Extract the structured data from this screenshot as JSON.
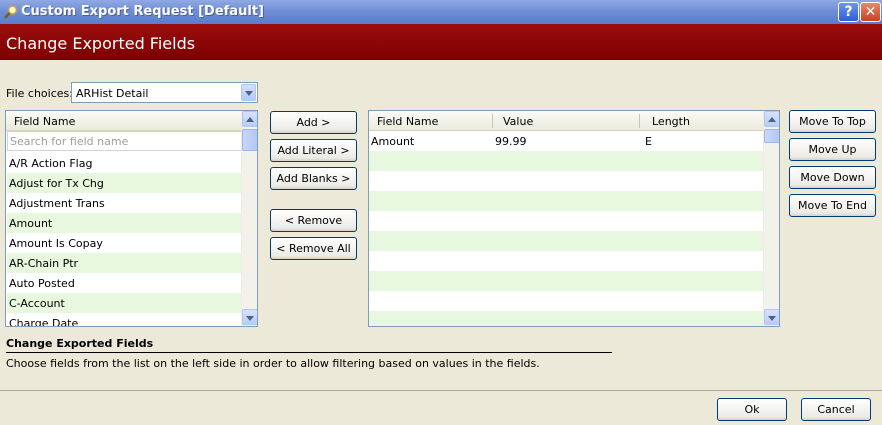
{
  "window": {
    "title": "Custom Export Request [Default]",
    "help_label": "?",
    "close_label": "✕"
  },
  "banner": {
    "title": "Change Exported Fields"
  },
  "file_choices": {
    "label": "File choices:",
    "selected": "ARHist Detail"
  },
  "left_list": {
    "header": "Field Name",
    "search_placeholder": "Search for field name",
    "items": [
      "A/R Action Flag",
      "Adjust for Tx Chg",
      "Adjustment Trans",
      "Amount",
      "Amount Is Copay",
      "AR-Chain Ptr",
      "Auto Posted",
      "C-Account",
      "Charge Date"
    ]
  },
  "middle_buttons": {
    "add": "Add >",
    "add_literal": "Add Literal >",
    "add_blanks": "Add Blanks >",
    "remove": "< Remove",
    "remove_all": "< Remove All"
  },
  "right_table": {
    "headers": [
      "Field Name",
      "Value",
      "Length"
    ],
    "rows": [
      {
        "field": "Amount",
        "value": "99.99",
        "length": "E"
      }
    ]
  },
  "move_buttons": {
    "top": "Move To Top",
    "up": "Move Up",
    "down": "Move Down",
    "end": "Move To End"
  },
  "help": {
    "title": "Change Exported Fields",
    "text": "Choose fields from the list on the left side in order to allow filtering based on values in the fields."
  },
  "footer": {
    "ok": "Ok",
    "cancel": "Cancel"
  }
}
